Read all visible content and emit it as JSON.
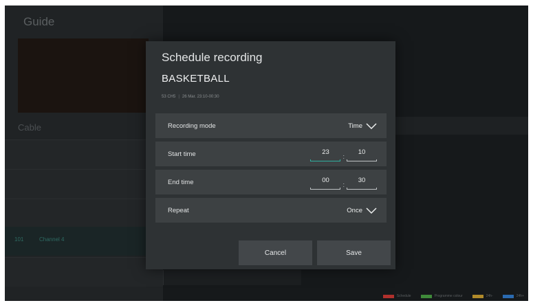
{
  "background": {
    "guide_title": "Guide",
    "section_label": "Cable",
    "channel_number": "101",
    "channel_name": "Channel 4",
    "legend": [
      {
        "label": "Schedule",
        "color": "#b0302c"
      },
      {
        "label": "Programme colour",
        "color": "#3f8a3a"
      },
      {
        "label": "24h-",
        "color": "#b08a2a"
      },
      {
        "label": "24h+",
        "color": "#2a6ab0"
      }
    ]
  },
  "dialog": {
    "title": "Schedule recording",
    "program_title": "BASKETBALL",
    "channel": "53 CH5",
    "airtime": "26 Mar. 23:10-00:30",
    "recording_mode": {
      "label": "Recording mode",
      "value": "Time",
      "icon": "chevron-down-icon"
    },
    "start_time": {
      "label": "Start time",
      "hour": "23",
      "minute": "10",
      "separator": ":"
    },
    "end_time": {
      "label": "End time",
      "hour": "00",
      "minute": "30",
      "separator": ":"
    },
    "repeat": {
      "label": "Repeat",
      "value": "Once",
      "icon": "chevron-down-icon"
    },
    "buttons": {
      "cancel": "Cancel",
      "save": "Save"
    }
  },
  "colors": {
    "accent": "#2fb0a0",
    "dialog_bg": "#2e3234",
    "row_bg": "#3d4143"
  }
}
